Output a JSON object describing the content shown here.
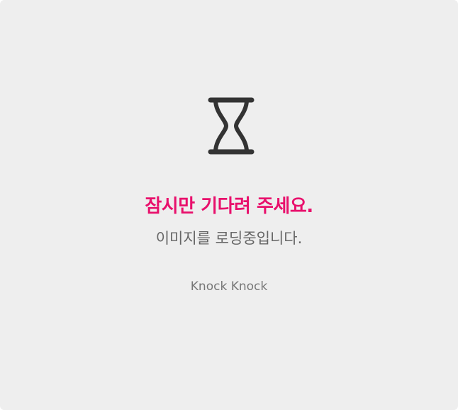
{
  "loading": {
    "icon": "hourglass-icon",
    "title": "잠시만 기다려 주세요.",
    "message": "이미지를 로딩중입니다.",
    "footer": "Knock Knock"
  },
  "colors": {
    "title": "#e8106c",
    "message": "#666666",
    "footer": "#777777",
    "icon": "#333333",
    "background": "#eeeeee"
  }
}
